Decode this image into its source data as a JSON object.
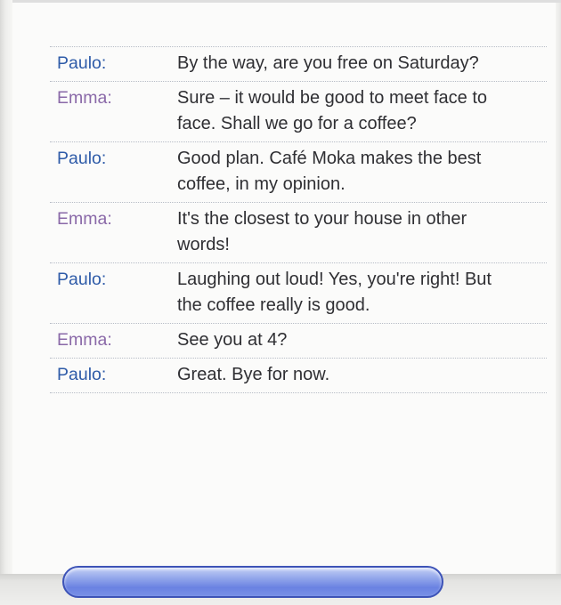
{
  "dialogue": [
    {
      "speaker": "Paulo:",
      "text": "By the way, are you free on Saturday?"
    },
    {
      "speaker": "Emma:",
      "text": "Sure – it would be good to meet face to face. Shall we go for a coffee?"
    },
    {
      "speaker": "Paulo:",
      "text": "Good plan. Café Moka makes the best coffee, in my opinion."
    },
    {
      "speaker": "Emma:",
      "text": "It's the closest to your house in other words!"
    },
    {
      "speaker": "Paulo:",
      "text": "Laughing out loud! Yes, you're right! But the coffee really is good."
    },
    {
      "speaker": "Emma:",
      "text": "See you at 4?"
    },
    {
      "speaker": "Paulo:",
      "text": "Great. Bye for now."
    }
  ],
  "colors": {
    "paulo": "#2e5ba8",
    "emma": "#8a69a8",
    "bar": "#6a82e2"
  }
}
